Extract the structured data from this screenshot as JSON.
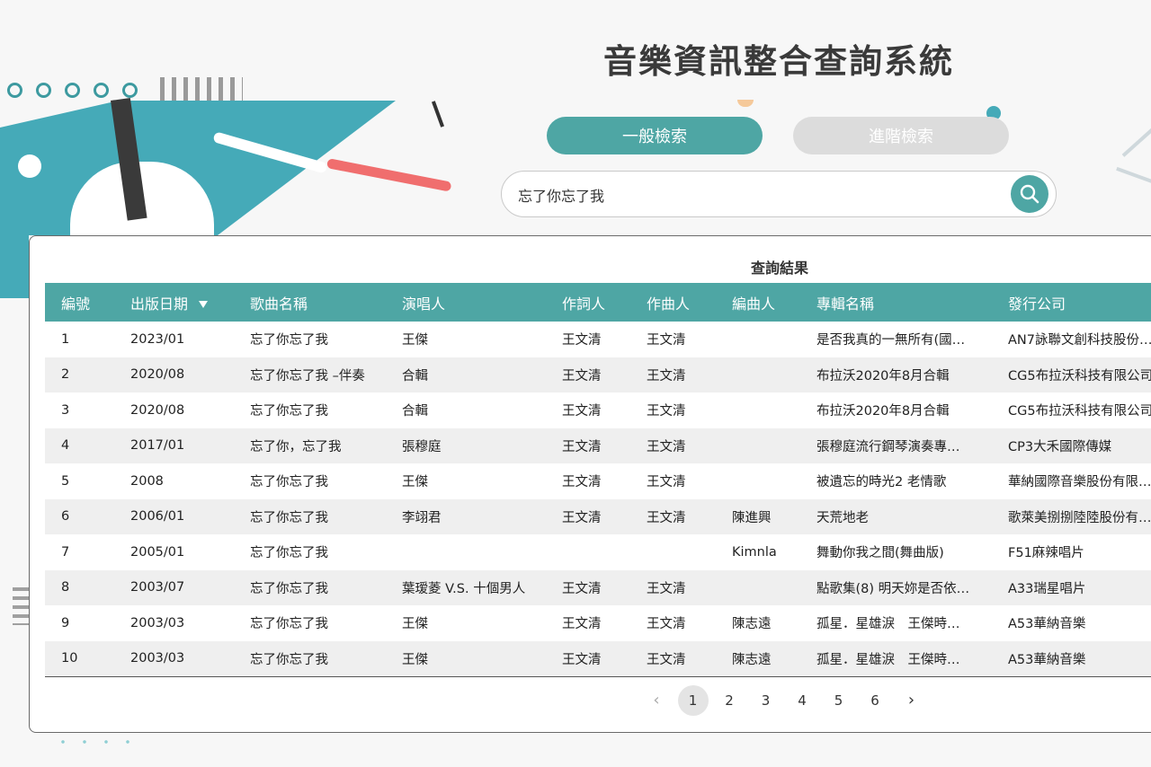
{
  "header": {
    "title": "音樂資訊整合查詢系統"
  },
  "tabs": {
    "basic": "一般檢索",
    "advanced": "進階檢索"
  },
  "search": {
    "value": "忘了你忘了我",
    "icon": "search-icon"
  },
  "results": {
    "title": "查詢結果",
    "sorted_column": "出版日期",
    "columns": [
      "編號",
      "出版日期",
      "歌曲名稱",
      "演唱人",
      "作詞人",
      "作曲人",
      "編曲人",
      "專輯名稱",
      "發行公司"
    ],
    "rows": [
      [
        "1",
        "2023/01",
        "忘了你忘了我",
        "王傑",
        "王文清",
        "王文清",
        "",
        "是否我真的一無所有(國…",
        "AN7詠聯文創科技股份…"
      ],
      [
        "2",
        "2020/08",
        "忘了你忘了我 –伴奏",
        "合輯",
        "王文清",
        "王文清",
        "",
        "布拉沃2020年8月合輯",
        "CG5布拉沃科技有限公司"
      ],
      [
        "3",
        "2020/08",
        "忘了你忘了我",
        "合輯",
        "王文清",
        "王文清",
        "",
        "布拉沃2020年8月合輯",
        "CG5布拉沃科技有限公司"
      ],
      [
        "4",
        "2017/01",
        "忘了你，忘了我",
        "張穆庭",
        "王文清",
        "王文清",
        "",
        "張穆庭流行鋼琴演奏專…",
        "CP3大禾國際傳媒"
      ],
      [
        "5",
        "2008",
        "忘了你忘了我",
        "王傑",
        "王文清",
        "王文清",
        "",
        "被遺忘的時光2 老情歌",
        "華納國際音樂股份有限…"
      ],
      [
        "6",
        "2006/01",
        "忘了你忘了我",
        "李翊君",
        "王文清",
        "王文清",
        "陳進興",
        "天荒地老",
        "歌萊美捌捌陸陸股份有…"
      ],
      [
        "7",
        "2005/01",
        "忘了你忘了我",
        "",
        "",
        "",
        "Kimnla",
        "舞動你我之間(舞曲版)",
        "F51麻辣唱片"
      ],
      [
        "8",
        "2003/07",
        "忘了你忘了我",
        "葉瑷菱 V.S. 十個男人",
        "王文清",
        "王文清",
        "",
        "點歌集(8) 明天妳是否依…",
        "A33瑞星唱片"
      ],
      [
        "9",
        "2003/03",
        "忘了你忘了我",
        "王傑",
        "王文清",
        "王文清",
        "陳志遠",
        "孤星．星雄淚　王傑時…",
        "A53華納音樂"
      ],
      [
        "10",
        "2003/03",
        "忘了你忘了我",
        "王傑",
        "王文清",
        "王文清",
        "陳志遠",
        "孤星．星雄淚　王傑時…",
        "A53華納音樂"
      ]
    ]
  },
  "pagination": {
    "prev": "‹",
    "next": "›",
    "pages": [
      "1",
      "2",
      "3",
      "4",
      "5",
      "6"
    ],
    "current": "1"
  },
  "colors": {
    "accent": "#4ea6a4",
    "decor_teal": "#45aab8",
    "decor_red": "#f06e6e"
  }
}
